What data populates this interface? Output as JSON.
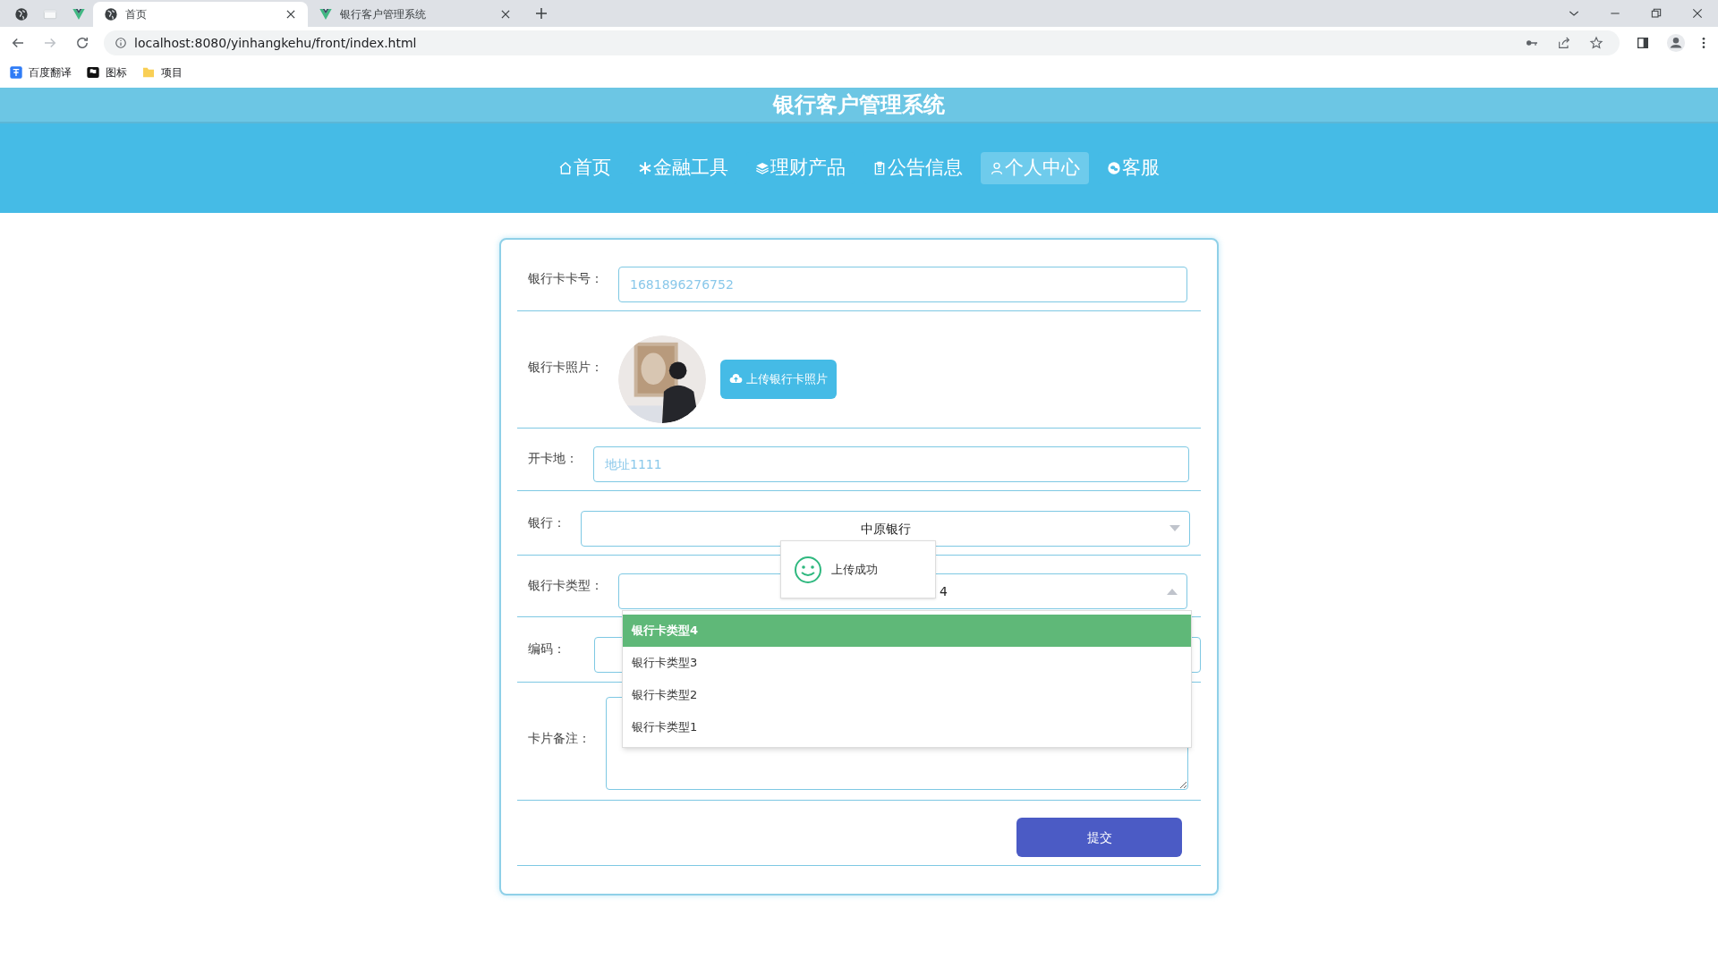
{
  "browser": {
    "tabs": [
      {
        "selected": false
      },
      {
        "selected": false
      },
      {
        "selected": false
      },
      {
        "title": "首页",
        "selected": true
      },
      {
        "title": "银行客户管理系统",
        "selected": false
      }
    ],
    "address": "localhost:8080/yinhangkehu/front/index.html",
    "bookmarks": [
      "百度翻译",
      "图标",
      "项目"
    ]
  },
  "site_title": "银行客户管理系统",
  "nav": [
    {
      "label": "首页",
      "selected": false
    },
    {
      "label": "金融工具",
      "selected": false
    },
    {
      "label": "理财产品",
      "selected": false
    },
    {
      "label": "公告信息",
      "selected": false
    },
    {
      "label": "个人中心",
      "selected": true
    },
    {
      "label": "客服",
      "selected": false
    }
  ],
  "form": {
    "card_number": {
      "label": "银行卡卡号：",
      "value": "1681896276752"
    },
    "photo": {
      "label": "银行卡照片：",
      "upload_button": "上传银行卡照片"
    },
    "address": {
      "label": "开卡地：",
      "value": "地址1111"
    },
    "bank": {
      "label": "银行：",
      "value": "中原银行"
    },
    "card_type": {
      "label": "银行卡类型：",
      "value": "4",
      "expanded": true,
      "options": [
        {
          "label": "银行卡类型4",
          "selected": true
        },
        {
          "label": "银行卡类型3",
          "selected": false
        },
        {
          "label": "银行卡类型2",
          "selected": false
        },
        {
          "label": "银行卡类型1",
          "selected": false
        }
      ]
    },
    "code": {
      "label": "编码："
    },
    "remark": {
      "label": "卡片备注："
    },
    "submit": "提交"
  },
  "toast": {
    "message": "上传成功"
  }
}
